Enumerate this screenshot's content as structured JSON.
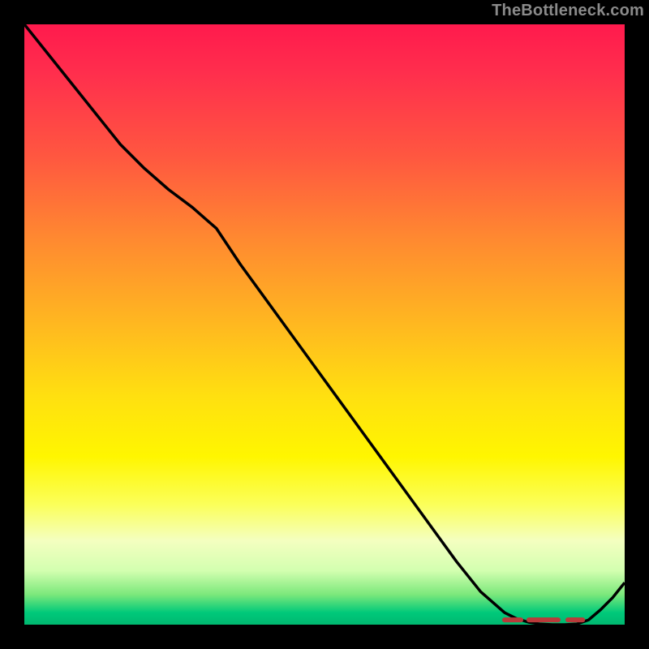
{
  "watermark": "TheBottleneck.com",
  "chart_data": {
    "type": "line",
    "x": [
      0.0,
      0.04,
      0.08,
      0.12,
      0.16,
      0.2,
      0.24,
      0.28,
      0.32,
      0.36,
      0.4,
      0.44,
      0.48,
      0.52,
      0.56,
      0.6,
      0.64,
      0.68,
      0.72,
      0.76,
      0.8,
      0.82,
      0.84,
      0.86,
      0.88,
      0.9,
      0.92,
      0.94,
      0.96,
      0.98,
      1.0
    ],
    "y": [
      1.0,
      0.95,
      0.9,
      0.85,
      0.8,
      0.76,
      0.725,
      0.695,
      0.66,
      0.6,
      0.545,
      0.49,
      0.435,
      0.38,
      0.325,
      0.27,
      0.215,
      0.16,
      0.105,
      0.055,
      0.02,
      0.01,
      0.004,
      0.001,
      0.0,
      0.0,
      0.001,
      0.008,
      0.025,
      0.045,
      0.07
    ],
    "xlim": [
      0,
      1
    ],
    "ylim": [
      0,
      1
    ],
    "highlight_range_x": [
      0.8,
      0.93
    ]
  }
}
